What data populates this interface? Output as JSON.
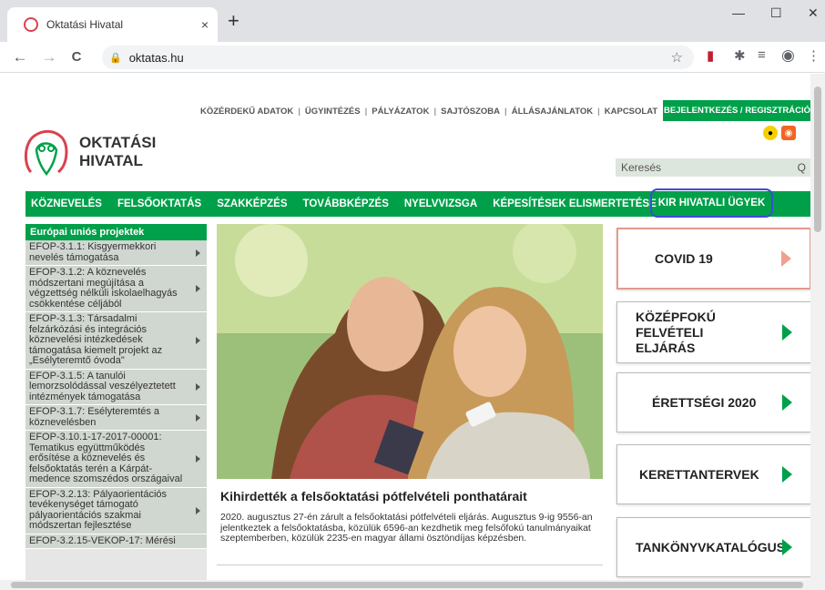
{
  "browser": {
    "tab_title": "Oktatási Hivatal",
    "tab_close": "×",
    "new_tab": "+",
    "win_min": "—",
    "win_max": "☐",
    "win_close": "✕",
    "back": "←",
    "forward": "→",
    "reload": "C",
    "url": "oktatas.hu",
    "bookmark": "☆",
    "menu": "⋮"
  },
  "site": {
    "top_links": [
      "KÖZÉRDEKŰ ADATOK",
      "ÜGYINTÉZÉS",
      "PÁLYÁZATOK",
      "SAJTÓSZOBA",
      "ÁLLÁSAJÁNLATOK",
      "KAPCSOLAT"
    ],
    "login_label": "BEJELENTKEZÉS / REGISZTRÁCIÓ",
    "logo_line1": "OKTATÁSI",
    "logo_line2": "HIVATAL",
    "search_placeholder": "Keresés",
    "search_icon": "Q",
    "main_nav": [
      "KÖZNEVELÉS",
      "FELSŐOKTATÁS",
      "SZAKKÉPZÉS",
      "TOVÁBBKÉPZÉS",
      "NYELVVIZSGA",
      "KÉPESÍTÉSEK ELISMERTETÉSE"
    ],
    "kir_label": "KIR HIVATALI ÜGYEK",
    "sidebar_head": "Európai uniós projektek",
    "sidebar_items": [
      "EFOP-3.1.1: Kisgyermekkori nevelés támogatása",
      "EFOP-3.1.2: A köznevelés módszertani megújítása a végzettség nélküli iskolaelhagyás csökkentése céljából",
      "EFOP-3.1.3: Társadalmi felzárkózási és integrációs köznevelési intézkedések támogatása kiemelt projekt az „Esélyteremtő óvoda\"",
      "EFOP-3.1.5: A tanulói lemorzsolódással veszélyeztetett intézmények támogatása",
      "EFOP-3.1.7: Esélyteremtés a köznevelésben",
      "EFOP-3.10.1-17-2017-00001: Tematikus együttműködés erősítése a köznevelés és felsőoktatás terén a Kárpát-medence szomszédos országaival",
      "EFOP-3.2.13: Pályaorientációs tevékenységet támogató pályaorientációs szakmai módszertan fejlesztése",
      "EFOP-3.2.15-VEKOP-17: Mérési"
    ],
    "news_title": "Kihirdették a felsőoktatási pótfelvételi ponthatárait",
    "news_text": "2020. augusztus 27-én zárult a felsőoktatási pótfelvételi eljárás. Augusztus 9-ig 9556-an jelentkeztek a felsőoktatásba, közülük 6596-an kezdhetik meg felsőfokú tanulmányaikat szeptemberben, közülük 2235-en magyar állami ösztöndíjas képzésben.",
    "tiles": [
      "COVID 19",
      "KÖZÉPFOKÚ FELVÉTELI ELJÁRÁS",
      "ÉRETTSÉGI 2020",
      "KERETTANTERVEK",
      "TANKÖNYVKATALÓGUS"
    ]
  }
}
